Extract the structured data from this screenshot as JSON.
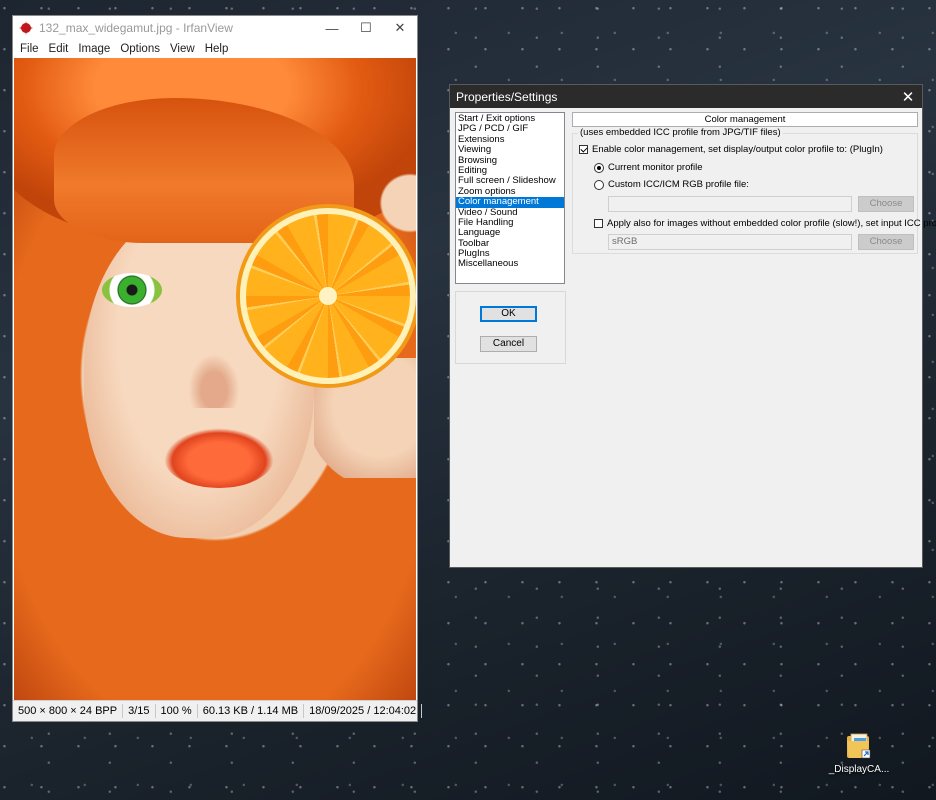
{
  "viewer": {
    "title": "132_max_widegamut.jpg - IrfanView",
    "menu": [
      "File",
      "Edit",
      "Image",
      "Options",
      "View",
      "Help"
    ],
    "status": {
      "dimensions": "500 × 800 × 24 BPP",
      "index": "3/15",
      "zoom": "100 %",
      "size": "60.13 KB / 1.14 MB",
      "datetime": "18/09/2025 / 12:04:02"
    }
  },
  "dialog": {
    "title": "Properties/Settings",
    "categories": [
      "Start / Exit options",
      "JPG / PCD / GIF",
      "Extensions",
      "Viewing",
      "Browsing",
      "Editing",
      "Full screen / Slideshow",
      "Zoom options",
      "Color management",
      "Video / Sound",
      "File Handling",
      "Language",
      "Toolbar",
      "PlugIns",
      "Miscellaneous"
    ],
    "selected_category": "Color management",
    "ok_label": "OK",
    "cancel_label": "Cancel",
    "page": {
      "header": "Color management",
      "group_label": "(uses embedded ICC profile from JPG/TIF files)",
      "enable_label": "Enable color management, set display/output color profile to: (PlugIn)",
      "enable_checked": true,
      "radio_monitor": "Current monitor profile",
      "radio_monitor_selected": true,
      "radio_custom": "Custom ICC/ICM RGB profile file:",
      "custom_path": "",
      "choose_label": "Choose",
      "apply_label": "Apply also for images without embedded color profile (slow!), set input ICC profile:",
      "apply_checked": false,
      "input_profile": "sRGB"
    }
  },
  "desktop": {
    "icon_label": "_DisplayCA..."
  }
}
